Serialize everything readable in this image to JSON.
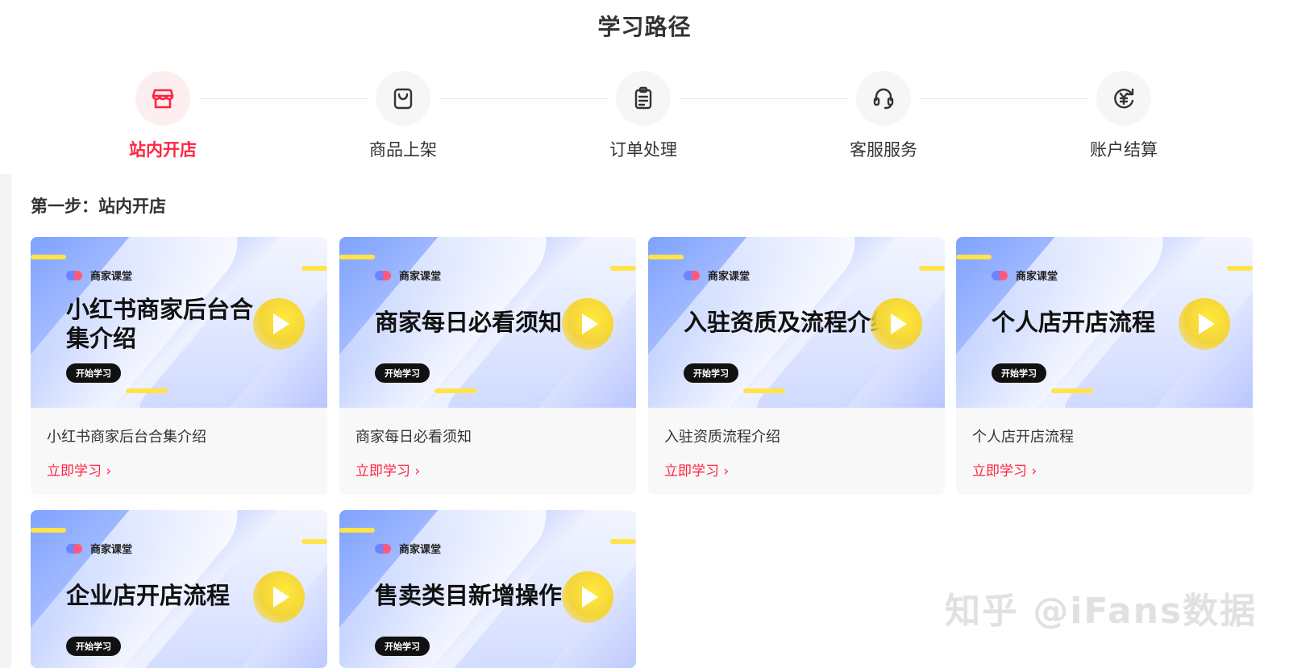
{
  "page": {
    "title": "学习路径"
  },
  "steps": [
    {
      "label": "站内开店",
      "icon": "store-icon",
      "active": true
    },
    {
      "label": "商品上架",
      "icon": "shopping-bag-icon",
      "active": false
    },
    {
      "label": "订单处理",
      "icon": "clipboard-icon",
      "active": false
    },
    {
      "label": "客服服务",
      "icon": "headset-icon",
      "active": false
    },
    {
      "label": "账户结算",
      "icon": "yen-refresh-icon",
      "active": false
    }
  ],
  "section": {
    "title": "第一步：站内开店"
  },
  "cards": [
    {
      "brand": "商家课堂",
      "cover_title": "小红书商家后台合集介绍",
      "badge": "开始学习",
      "name": "小红书商家后台合集介绍",
      "link": "立即学习 ›"
    },
    {
      "brand": "商家课堂",
      "cover_title": "商家每日必看须知",
      "badge": "开始学习",
      "name": "商家每日必看须知",
      "link": "立即学习 ›"
    },
    {
      "brand": "商家课堂",
      "cover_title": "入驻资质及流程介绍",
      "badge": "开始学习",
      "name": "入驻资质流程介绍",
      "link": "立即学习 ›"
    },
    {
      "brand": "商家课堂",
      "cover_title": "个人店开店流程",
      "badge": "开始学习",
      "name": "个人店开店流程",
      "link": "立即学习 ›"
    },
    {
      "brand": "商家课堂",
      "cover_title": "企业店开店流程",
      "badge": "开始学习",
      "name": "",
      "link": ""
    },
    {
      "brand": "商家课堂",
      "cover_title": "售卖类目新增操作",
      "badge": "开始学习",
      "name": "",
      "link": ""
    }
  ],
  "watermark": "知乎 @iFans数据",
  "colors": {
    "accent": "#ff2442",
    "badge_bg": "#111111",
    "play": "#f4d43a"
  }
}
